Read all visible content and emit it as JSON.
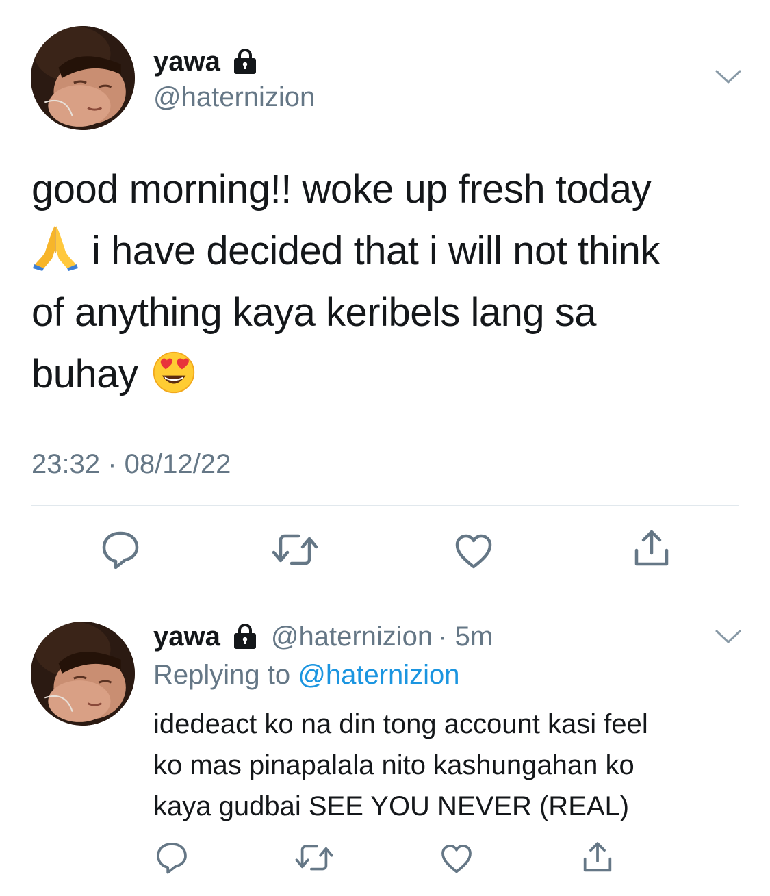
{
  "colors": {
    "text": "#14171a",
    "secondary": "#657786",
    "link": "#1b95e0",
    "divider": "#e1e8ed"
  },
  "main_tweet": {
    "name": "yawa",
    "handle": "@haternizion",
    "text_line1": "good morning!! woke up fresh today",
    "text_line2": "i have decided that i will not think",
    "text_line3": "of anything kaya keribels lang sa",
    "text_line4": "buhay",
    "emoji_1": "folded-hands",
    "emoji_2": "smiling-face-with-heart-eyes",
    "timestamp": "23:32 · 08/12/22",
    "actions": [
      "reply-icon",
      "retweet-icon",
      "like-icon",
      "share-icon"
    ]
  },
  "reply_tweet": {
    "name": "yawa",
    "handle": "@haternizion",
    "time": "· 5m",
    "replying_to_label": "Replying to",
    "replying_to_handle": "@haternizion",
    "text_line1": "idedeact ko na din tong account kasi feel",
    "text_line2": "ko mas pinapalala nito kashungahan ko",
    "text_line3": "kaya gudbai SEE YOU NEVER (REAL)",
    "actions": [
      "reply-icon",
      "retweet-icon",
      "like-icon",
      "share-icon"
    ]
  }
}
